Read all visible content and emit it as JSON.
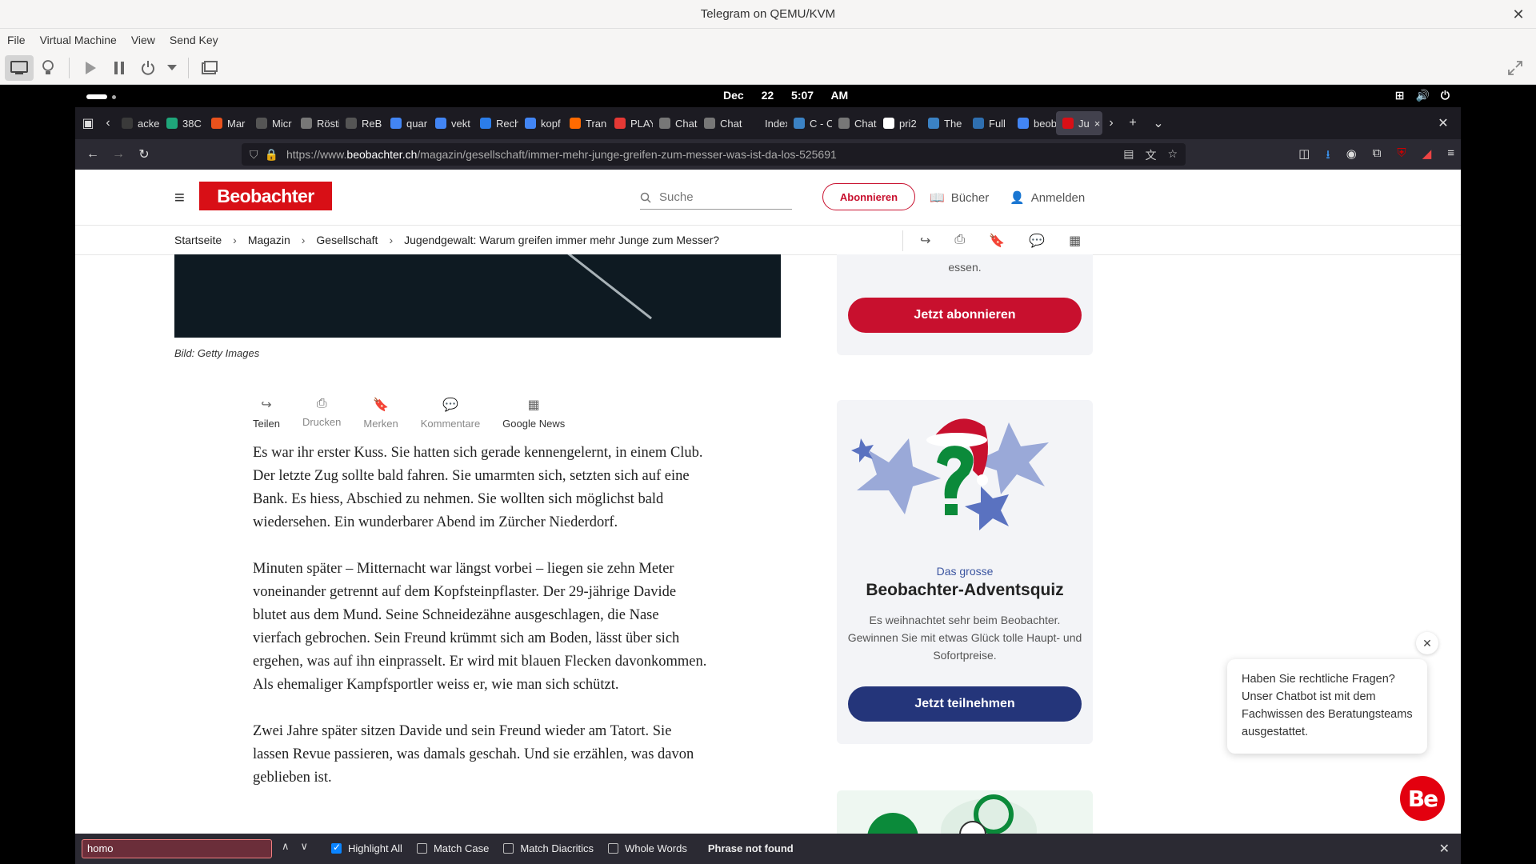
{
  "window": {
    "title": "Telegram on QEMU/KVM",
    "close": "✕"
  },
  "menu": [
    "File",
    "Virtual Machine",
    "View",
    "Send Key"
  ],
  "gnome": {
    "date": "Dec 22",
    "time": "5:07 AM"
  },
  "tabs": [
    {
      "label": "ackers",
      "color": "#3a3a3a"
    },
    {
      "label": "38C",
      "color": "#1fa67a"
    },
    {
      "label": "Mar",
      "color": "#e8521d"
    },
    {
      "label": "Micr",
      "color": "#555555"
    },
    {
      "label": "Rösti",
      "color": "#777777"
    },
    {
      "label": "ReB",
      "color": "#555555"
    },
    {
      "label": "quar",
      "color": "#4285f4"
    },
    {
      "label": "vekt",
      "color": "#4285f4"
    },
    {
      "label": "Rech",
      "color": "#2b7de9"
    },
    {
      "label": "kopf",
      "color": "#4285f4"
    },
    {
      "label": "Tran",
      "color": "#ff6a00"
    },
    {
      "label": "PLAY",
      "color": "#e53935"
    },
    {
      "label": "Chat",
      "color": "#777777"
    },
    {
      "label": "Chat",
      "color": "#777777"
    },
    {
      "label": "Index of",
      "color": "#1c1b22"
    },
    {
      "label": "C - C",
      "color": "#3b82c4"
    },
    {
      "label": "Chat",
      "color": "#777777"
    },
    {
      "label": "pri2",
      "color": "#ffffff"
    },
    {
      "label": "The",
      "color": "#3b82c4"
    },
    {
      "label": "Full",
      "color": "#2f6fb0"
    },
    {
      "label": "beob",
      "color": "#4285f4"
    },
    {
      "label": "Ju",
      "color": "#d80f16",
      "active": true
    }
  ],
  "url": {
    "prefix": "https://www.",
    "host": "beobachter.ch",
    "path": "/magazin/gesellschaft/immer-mehr-junge-greifen-zum-messer-was-ist-da-los-525691"
  },
  "site": {
    "logo": "Beobachter",
    "search_placeholder": "Suche",
    "subscribe": "Abonnieren",
    "books": "Bücher",
    "login": "Anmelden"
  },
  "breadcrumb": [
    "Startseite",
    "Magazin",
    "Gesellschaft",
    "Jugendgewalt: Warum greifen immer mehr Junge zum Messer?"
  ],
  "caption": "Bild: Getty Images",
  "actions": [
    "Teilen",
    "Drucken",
    "Merken",
    "Kommentare",
    "Google News"
  ],
  "article": [
    "Es war ihr erster Kuss. Sie hatten sich gerade kennengelernt, in einem Club. Der letzte Zug sollte bald fahren. Sie umarmten sich, setzten sich auf eine Bank. Es hiess, Abschied zu nehmen. Sie wollten sich möglichst bald wiedersehen. Ein wunderbarer Abend im Zürcher Niederdorf.",
    "Minuten später – Mitternacht war längst vorbei – liegen sie zehn Meter voneinander getrennt auf dem Kopfsteinpflaster. Der 29-jährige Davide blutet aus dem Mund. Seine Schneidezähne ausgeschlagen, die Nase vierfach gebrochen. Sein Freund krümmt sich am Boden, lässt über sich ergehen, was auf ihn einprasselt. Er wird mit blauen Flecken davonkommen. Als ehemaliger Kampfsportler weiss er, wie man sich schützt.",
    "Zwei Jahre später sitzen Davide und sein Freund wieder am Tatort. Sie lassen Revue passieren, was damals geschah. Und sie erzählen, was davon geblieben ist."
  ],
  "sidebar": {
    "promo_text": "essen.",
    "promo_button": "Jetzt abonnieren",
    "quiz_sub": "Das grosse",
    "quiz_title": "Beobachter-Adventsquiz",
    "quiz_desc": "Es weihnachtet sehr beim Beobachter. Gewinnen Sie mit etwas Glück tolle Haupt- und Sofortpreise.",
    "quiz_button": "Jetzt teilnehmen"
  },
  "chatbot": {
    "message": "Haben Sie rechtliche Fragen? Unser Chatbot ist mit dem Fachwissen des Beratungsteams ausgestattet.",
    "avatar": "Be"
  },
  "findbar": {
    "query": "homo",
    "highlight_all": "Highlight All",
    "match_case": "Match Case",
    "match_diacritics": "Match Diacritics",
    "whole_words": "Whole Words",
    "status": "Phrase not found"
  },
  "colors": {
    "brand_red": "#d80f16",
    "quiz_blue": "#24357a",
    "find_error": "#6b2e3a"
  }
}
